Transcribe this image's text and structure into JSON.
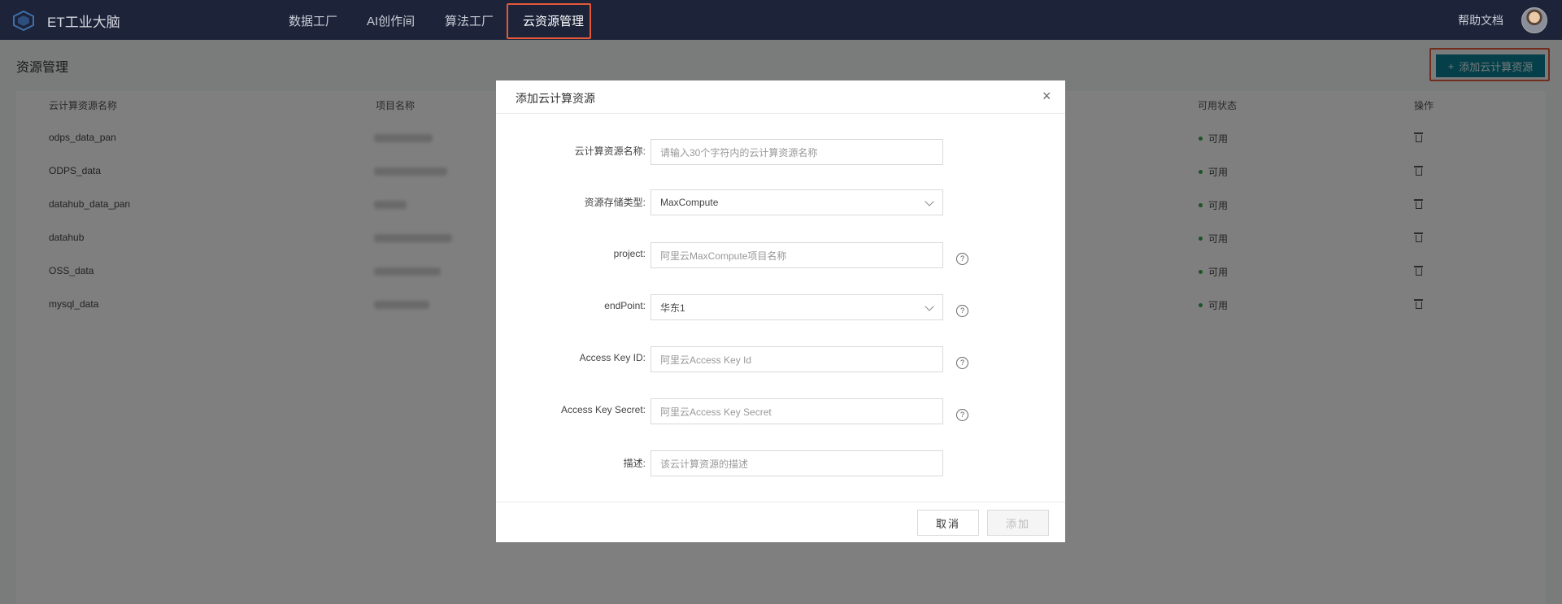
{
  "topbar": {
    "brand": "ET工业大脑",
    "nav": [
      "数据工厂",
      "AI创作间",
      "算法工厂",
      "云资源管理"
    ],
    "active_nav": "云资源管理",
    "help": "帮助文档"
  },
  "page": {
    "title": "资源管理",
    "add_button": "添加云计算资源"
  },
  "table": {
    "columns": [
      "云计算资源名称",
      "项目名称",
      "可用状态",
      "操作"
    ],
    "rows": [
      {
        "name": "odps_data_pan",
        "status": "可用"
      },
      {
        "name": "ODPS_data",
        "status": "可用"
      },
      {
        "name": "datahub_data_pan",
        "status": "可用"
      },
      {
        "name": "datahub",
        "status": "可用"
      },
      {
        "name": "OSS_data",
        "status": "可用"
      },
      {
        "name": "mysql_data",
        "status": "可用"
      }
    ]
  },
  "modal": {
    "title": "添加云计算资源",
    "fields": [
      {
        "label": "云计算资源名称:",
        "placeholder": "请输入30个字符内的云计算资源名称"
      },
      {
        "label": "资源存储类型:",
        "value": "MaxCompute"
      },
      {
        "label": "project:",
        "placeholder": "阿里云MaxCompute项目名称"
      },
      {
        "label": "endPoint:",
        "value": "华东1"
      },
      {
        "label": "Access Key ID:",
        "placeholder": "阿里云Access Key Id"
      },
      {
        "label": "Access Key Secret:",
        "placeholder": "阿里云Access Key Secret"
      },
      {
        "label": "描述:",
        "placeholder": "该云计算资源的描述"
      }
    ],
    "cancel": "取消",
    "submit": "添加"
  },
  "colors": {
    "topbar_bg": "#1d2339",
    "accent": "#0b7f92",
    "highlight_box": "#e3583a",
    "status_ok": "#3aa74a"
  }
}
